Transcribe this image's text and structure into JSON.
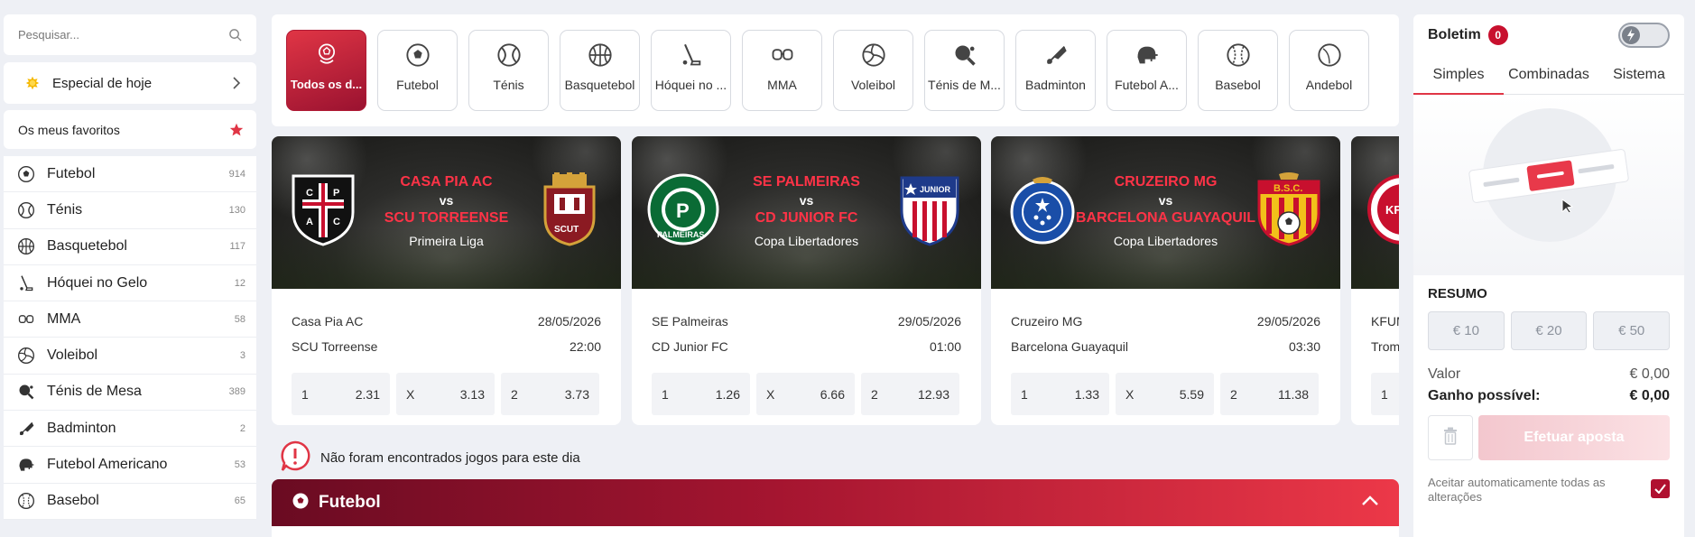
{
  "search": {
    "placeholder": "Pesquisar..."
  },
  "sidebar": {
    "special_label": "Especial de hoje",
    "favorites_label": "Os meus favoritos",
    "sports": [
      {
        "name": "Futebol",
        "count": "914",
        "icon": "soccer-ball-icon"
      },
      {
        "name": "Ténis",
        "count": "130",
        "icon": "tennis-ball-icon"
      },
      {
        "name": "Basquetebol",
        "count": "117",
        "icon": "basketball-icon"
      },
      {
        "name": "Hóquei no Gelo",
        "count": "12",
        "icon": "hockey-stick-icon"
      },
      {
        "name": "MMA",
        "count": "58",
        "icon": "mma-gloves-icon"
      },
      {
        "name": "Voleibol",
        "count": "3",
        "icon": "volleyball-icon"
      },
      {
        "name": "Ténis de Mesa",
        "count": "389",
        "icon": "table-tennis-icon"
      },
      {
        "name": "Badminton",
        "count": "2",
        "icon": "shuttlecock-icon"
      },
      {
        "name": "Futebol Americano",
        "count": "53",
        "icon": "football-helmet-icon"
      },
      {
        "name": "Basebol",
        "count": "65",
        "icon": "baseball-icon"
      }
    ]
  },
  "categories": [
    {
      "label": "Todos os d...",
      "active": true
    },
    {
      "label": "Futebol"
    },
    {
      "label": "Ténis"
    },
    {
      "label": "Basquetebol"
    },
    {
      "label": "Hóquei no ..."
    },
    {
      "label": "MMA"
    },
    {
      "label": "Voleibol"
    },
    {
      "label": "Ténis de M..."
    },
    {
      "label": "Badminton"
    },
    {
      "label": "Futebol A..."
    },
    {
      "label": "Basebol"
    },
    {
      "label": "Andebol"
    }
  ],
  "matches": [
    {
      "home_banner": "CASA PIA AC",
      "vs": "vs",
      "away_banner": "SCU TORREENSE",
      "league": "Primeira Liga",
      "home": "Casa Pia AC",
      "away": "SCU Torreense",
      "date": "28/05/2026",
      "time": "22:00",
      "odds": [
        {
          "k": "1",
          "v": "2.31"
        },
        {
          "k": "X",
          "v": "3.13"
        },
        {
          "k": "2",
          "v": "3.73"
        }
      ]
    },
    {
      "home_banner": "SE PALMEIRAS",
      "vs": "vs",
      "away_banner": "CD JUNIOR FC",
      "league": "Copa Libertadores",
      "home": "SE Palmeiras",
      "away": "CD Junior FC",
      "date": "29/05/2026",
      "time": "01:00",
      "odds": [
        {
          "k": "1",
          "v": "1.26"
        },
        {
          "k": "X",
          "v": "6.66"
        },
        {
          "k": "2",
          "v": "12.93"
        }
      ]
    },
    {
      "home_banner": "CRUZEIRO MG",
      "vs": "vs",
      "away_banner": "BARCELONA GUAYAQUIL",
      "league": "Copa Libertadores",
      "home": "Cruzeiro MG",
      "away": "Barcelona Guayaquil",
      "date": "29/05/2026",
      "time": "03:30",
      "odds": [
        {
          "k": "1",
          "v": "1.33"
        },
        {
          "k": "X",
          "v": "5.59"
        },
        {
          "k": "2",
          "v": "11.38"
        }
      ]
    },
    {
      "home": "KFUM",
      "away": "Trom",
      "odds": [
        {
          "k": "1",
          "v": ""
        }
      ]
    }
  ],
  "no_games_text": "Não foram encontrados jogos para este dia",
  "section_title": "Futebol",
  "betslip": {
    "title": "Boletim",
    "count": "0",
    "tabs": [
      "Simples",
      "Combinadas",
      "Sistema"
    ],
    "summary_label": "RESUMO",
    "stakes": [
      "€ 10",
      "€ 20",
      "€ 50"
    ],
    "value_label": "Valor",
    "value": "€ 0,00",
    "win_label": "Ganho possível:",
    "win": "€ 0,00",
    "place_label": "Efetuar aposta",
    "accept_label": "Aceitar automaticamente todas as alterações"
  },
  "colors": {
    "accent": "#e03545",
    "dark_red": "#9a1230",
    "odds_bg": "#f2f3f6",
    "page_bg": "#eef0f5"
  }
}
